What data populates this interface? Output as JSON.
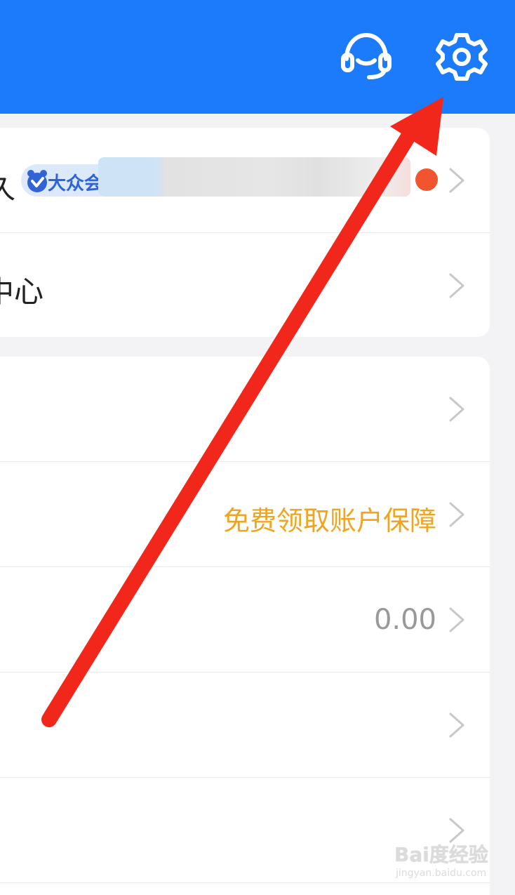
{
  "header": {
    "customer_service_icon": "headset-icon",
    "settings_icon": "gear-icon",
    "background": "#1c7bfb"
  },
  "account_card": {
    "rows": [
      {
        "partial_label": "久",
        "badge": {
          "text": "大众会",
          "icon": "badge-v-icon"
        },
        "has_red_dot": true
      },
      {
        "partial_label": "中心"
      }
    ]
  },
  "main_card": {
    "rows": [
      {
        "value": ""
      },
      {
        "value": "免费领取账户保障"
      },
      {
        "value": "0.00"
      },
      {
        "value": ""
      },
      {
        "value": ""
      }
    ]
  },
  "colors": {
    "accent": "#1c7bfb",
    "promo_text": "#f0a51e",
    "muted_text": "#999999",
    "red_dot": "#f2542d",
    "annotation_arrow": "#f2271b"
  },
  "annotation": {
    "type": "red-arrow-pointing-to-settings"
  },
  "watermark": {
    "text": "Bai度经验",
    "subtext": "jingyan.baidu.com"
  }
}
